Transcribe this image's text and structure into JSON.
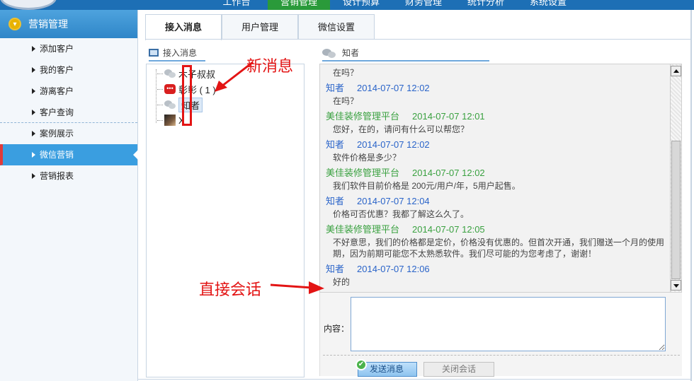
{
  "topnav": [
    "工作台",
    "营销管理",
    "设计预算",
    "财务管理",
    "统计分析",
    "系统设置"
  ],
  "sidebar": {
    "title": "营销管理",
    "items": [
      {
        "label": "添加客户"
      },
      {
        "label": "我的客户"
      },
      {
        "label": "游离客户"
      },
      {
        "label": "客户查询"
      },
      {
        "label": "案例展示"
      },
      {
        "label": "微信营销"
      },
      {
        "label": "营销报表"
      }
    ]
  },
  "tabs": [
    "接入消息",
    "用户管理",
    "微信设置"
  ],
  "sessions_panel": {
    "title": "接入消息",
    "items": [
      {
        "name": "木子叔叔"
      },
      {
        "name": "彰彰 ( 1 )"
      },
      {
        "name": "知者"
      },
      {
        "name": "X"
      }
    ]
  },
  "chat": {
    "title": "知者",
    "messages": [
      {
        "role": "customer",
        "from": "",
        "time": "",
        "text": "在吗？"
      },
      {
        "role": "customer",
        "from": "知者",
        "time": "2014-07-07 12:02",
        "text": "在吗？"
      },
      {
        "role": "agent",
        "from": "美佳装修管理平台",
        "time": "2014-07-07 12:01",
        "text": "您好，在的，请问有什么可以帮您？"
      },
      {
        "role": "customer",
        "from": "知者",
        "time": "2014-07-07 12:02",
        "text": "软件价格是多少？"
      },
      {
        "role": "agent",
        "from": "美佳装修管理平台",
        "time": "2014-07-07 12:02",
        "text": "我们软件目前价格是 200元/用户/年，5用户起售。"
      },
      {
        "role": "customer",
        "from": "知者",
        "time": "2014-07-07 12:04",
        "text": "价格可否优惠？我都了解这么久了。"
      },
      {
        "role": "agent",
        "from": "美佳装修管理平台",
        "time": "2014-07-07 12:05",
        "text": "不好意思，我们的价格都是定价，价格没有优惠的。但首次开通，我们赠送一个月的使用期，因为前期可能您不太熟悉软件。我们尽可能的为您考虑了，谢谢！"
      },
      {
        "role": "customer",
        "from": "知者",
        "time": "2014-07-07 12:06",
        "text": "好的"
      }
    ]
  },
  "compose": {
    "label": "内容：",
    "value": "",
    "send_label": "发送消息",
    "close_label": "关闭会话"
  },
  "annotations": {
    "new_message": "新消息",
    "direct_session": "直接会话"
  },
  "colors": {
    "sidebar_active": "#3a9ee0",
    "customer_name": "#2a64c9",
    "agent_name": "#3aa140",
    "annotation_red": "#e31414"
  }
}
